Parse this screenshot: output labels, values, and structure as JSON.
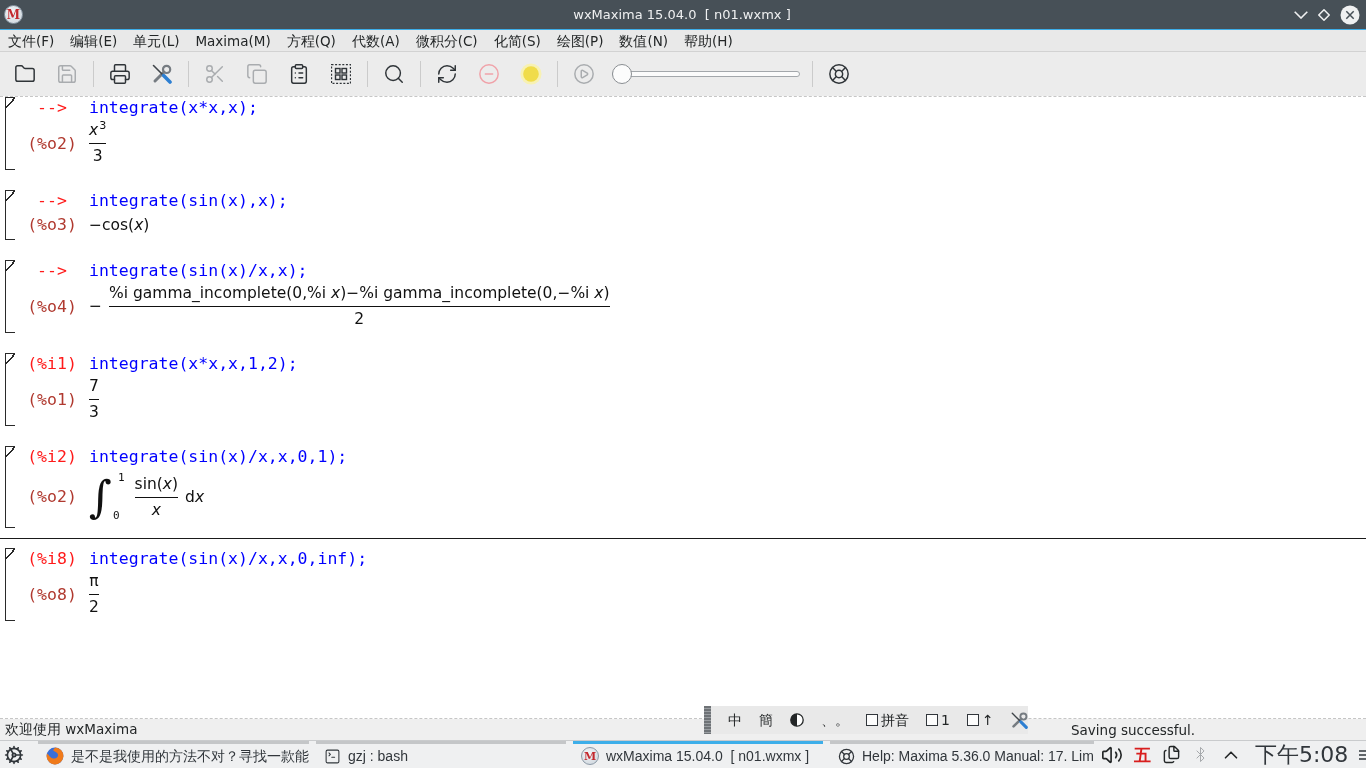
{
  "window": {
    "title": "wxMaxima 15.04.0  [ n01.wxmx ]",
    "logo_text": "M"
  },
  "menu": [
    "文件(F)",
    "编辑(E)",
    "单元(L)",
    "Maxima(M)",
    "方程(Q)",
    "代数(A)",
    "微积分(C)",
    "化简(S)",
    "绘图(P)",
    "数值(N)",
    "帮助(H)"
  ],
  "toolbar": {
    "groups": [
      [
        {
          "kind": "open",
          "disabled": false
        },
        {
          "kind": "save",
          "disabled": true
        }
      ],
      [
        {
          "kind": "print",
          "disabled": false
        },
        {
          "kind": "settings",
          "disabled": false
        }
      ],
      [
        {
          "kind": "cut",
          "disabled": true
        },
        {
          "kind": "copy",
          "disabled": true
        },
        {
          "kind": "paste",
          "disabled": false
        },
        {
          "kind": "select-all",
          "disabled": false
        }
      ],
      [
        {
          "kind": "find",
          "disabled": false
        }
      ],
      [
        {
          "kind": "reevaluate",
          "disabled": false
        },
        {
          "kind": "interrupt",
          "disabled": true
        },
        {
          "kind": "follow",
          "disabled": false
        }
      ],
      [
        {
          "kind": "play",
          "disabled": true
        },
        {
          "kind": "slider",
          "disabled": false,
          "level": 0
        }
      ],
      [
        {
          "kind": "help",
          "disabled": false
        }
      ]
    ]
  },
  "worksheet": {
    "cells": [
      {
        "prompt": "-->",
        "input": "integrate(x*x,x);",
        "output_label": "(%o2)",
        "output": {
          "kind": "fraction",
          "numerator": "*x*$^{3}$",
          "denominator": "3"
        },
        "cursor_above": false
      },
      {
        "prompt": "-->",
        "input": "integrate(sin(x),x);",
        "output_label": "(%o3)",
        "output": {
          "kind": "text",
          "text": "−cos(*x*)"
        },
        "cursor_above": false
      },
      {
        "prompt": "-->",
        "input": "integrate(sin(x)/x,x);",
        "output_label": "(%o4)",
        "output": {
          "kind": "fraction",
          "sign": "−",
          "numerator": "%i gamma_incomplete(0,%i *x*)−%i gamma_incomplete(0,−%i *x*)",
          "denominator": "2"
        },
        "cursor_above": false
      },
      {
        "prompt": "(%i1)",
        "input": "integrate(x*x,x,1,2);",
        "output_label": "(%o1)",
        "output": {
          "kind": "fraction",
          "numerator": "7",
          "denominator": "3"
        },
        "cursor_above": false
      },
      {
        "prompt": "(%i2)",
        "input": "integrate(sin(x)/x,x,0,1);",
        "output_label": "(%o2)",
        "output": {
          "kind": "integral",
          "symbol": "∫",
          "upper": "1",
          "lower": "0",
          "numerator": "sin(*x*)",
          "denominator": "x",
          "denominator_italic": true,
          "differential": "d",
          "variable": "x"
        },
        "cursor_above": false
      },
      {
        "prompt": "(%i8)",
        "input": "integrate(sin(x)/x,x,0,inf);",
        "output_label": "(%o8)",
        "output": {
          "kind": "fraction",
          "numerator": "π",
          "denominator": "2"
        },
        "cursor_above": true
      }
    ]
  },
  "input_method_bar": {
    "items": [
      {
        "kind": "label",
        "text": "中"
      },
      {
        "kind": "label",
        "text": "簡"
      },
      {
        "kind": "half-width"
      },
      {
        "kind": "label",
        "text": "、。"
      },
      {
        "kind": "checkbox",
        "text": "拼音",
        "checked": false
      },
      {
        "kind": "checkbox",
        "text": "1",
        "checked": false
      },
      {
        "kind": "checkbox",
        "text": "↑",
        "checked": false
      },
      {
        "kind": "settings"
      }
    ]
  },
  "status_bar": {
    "message": "欢迎使用 wxMaxima",
    "status": "Saving successful."
  },
  "taskbar": {
    "tasks": [
      {
        "kind": "browser",
        "label": "是不是我使用的方法不对？寻找一款能",
        "selected": false
      },
      {
        "kind": "terminal",
        "label": "gzj : bash",
        "selected": false
      },
      {
        "kind": "wxmaxima",
        "logo_text": "M",
        "label": "wxMaxima 15.04.0  [ n01.wxmx ]",
        "selected": true
      },
      {
        "kind": "help",
        "label": "Help: Maxima 5.36.0 Manual: 17. Lim",
        "selected": false
      }
    ],
    "tray": [
      {
        "kind": "volume",
        "disabled": false
      },
      {
        "kind": "input-method",
        "label": "五",
        "disabled": false
      },
      {
        "kind": "clipboard",
        "disabled": false
      },
      {
        "kind": "bluetooth",
        "disabled": true
      },
      {
        "kind": "expand",
        "disabled": false
      }
    ],
    "clock": "下午5:08"
  }
}
